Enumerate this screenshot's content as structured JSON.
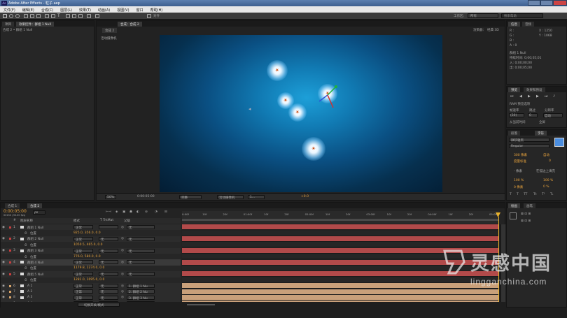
{
  "window": {
    "title": "Adobe After Effects - 粒子.aep"
  },
  "menu": [
    "文件(F)",
    "编辑(E)",
    "合成(C)",
    "图层(L)",
    "效果(T)",
    "动画(A)",
    "视图(V)",
    "窗口",
    "帮助(H)"
  ],
  "toolbar": {
    "snap_label": "对齐",
    "workspace_label": "工作区：",
    "workspace_value": "所有",
    "search_placeholder": "搜索帮助"
  },
  "project_panel": {
    "tabs": [
      "项目",
      "效果控件：群组 1 Null"
    ],
    "breadcrumb": "合成 2 • 群组 1 Null"
  },
  "comp_panel": {
    "tab": "合成：合成 2",
    "subtab": "合成 2",
    "renderer_label": "渲染器：",
    "renderer_value": "经典 3D",
    "camera_label": "活动摄像机",
    "footer": {
      "zoom": "50%",
      "timecode": "0:00:05:00",
      "resolution": "完整",
      "view": "活动摄像机",
      "views": "1...",
      "exposure": "+0.0"
    }
  },
  "info_panel": {
    "tabs": [
      "信息",
      "音频"
    ],
    "rgb": [
      "R :",
      "G :",
      "B :",
      "A : 0"
    ],
    "coords": [
      "X : 1250",
      "Y : 1068"
    ],
    "layer": "群组 1 Null",
    "duration": "持续时间: 0;00;05;01",
    "in": "入: 0;00;00;00",
    "out": "出: 0;00;05;00"
  },
  "preview_panel": {
    "tabs": [
      "预览",
      "效果和预设"
    ],
    "ram_label": "RAM 预览选项",
    "frame_rate_label": "帧速率",
    "skip_label": "跳过",
    "resolution_label": "分辨率",
    "frame_rate_value": "(30)",
    "skip_value": "0",
    "resolution_value": "自动",
    "from_current": "从当前时间",
    "full_screen": "全屏"
  },
  "character_panel": {
    "tabs": [
      "段落",
      "字符"
    ],
    "font": "微软雅黑",
    "style": "Regular",
    "size": "300 像素",
    "leading": "自动",
    "kerning": "度量标准",
    "tracking": "0",
    "stroke_width": "- 像素",
    "stroke_type": "在描边上填充",
    "vertical_scale": "100 %",
    "horizontal_scale": "100 %",
    "baseline": "0 像素",
    "tsume": "0 %",
    "fill_color": "#4b8ee0"
  },
  "paint_panel": {
    "tabs": [
      "绘画",
      "画笔"
    ]
  },
  "timeline": {
    "tabs": [
      "合成 1",
      "合成 2"
    ],
    "timecode": "0:00:05:00",
    "fps": "00150 (30.00 fps)",
    "search_placeholder": "ρ▾",
    "columns": {
      "num": "#",
      "name": "图层名称",
      "mode": "模式",
      "trkmat": "T TrkMat",
      "parent": "父级"
    },
    "ruler": [
      "0:00f",
      "10f",
      "20f",
      "01:00f",
      "10f",
      "20f",
      "02:00f",
      "10f",
      "20f",
      "03:00f",
      "10f",
      "20f",
      "04:00f",
      "10f",
      "20f",
      "05:00"
    ],
    "layers": [
      {
        "num": "1",
        "name": "群组 1 Null",
        "mode": "正常",
        "trk": "",
        "parent": "无",
        "color": "#c93f3f"
      },
      {
        "sub": true,
        "name": "位置",
        "value": "925.0, 356.0, 0.0"
      },
      {
        "num": "2",
        "name": "群组 2 Null",
        "mode": "正常",
        "trk": "无",
        "parent": "无",
        "color": "#c93f3f"
      },
      {
        "sub": true,
        "name": "位置",
        "value": "1050.5, 465.0, 0.0"
      },
      {
        "num": "3",
        "name": "群组 3 Null",
        "mode": "正常",
        "trk": "无",
        "parent": "无",
        "color": "#c93f3f"
      },
      {
        "sub": true,
        "name": "位置",
        "value": "776.0, 580.0, 0.0"
      },
      {
        "num": "4",
        "name": "群组 4 Null",
        "mode": "正常",
        "trk": "无",
        "parent": "无",
        "color": "#c93f3f",
        "selected": true
      },
      {
        "sub": true,
        "name": "位置",
        "value": "1179.8, 1274.0, 0.0"
      },
      {
        "num": "5",
        "name": "群组 5 Null",
        "mode": "正常",
        "trk": "无",
        "parent": "无",
        "color": "#c93f3f"
      },
      {
        "sub": true,
        "name": "位置",
        "value": "1281.0, 1095.0, 0.0"
      },
      {
        "num": "6",
        "name": "A 1",
        "mode": "正常",
        "trk": "无",
        "parent": "1. 群组 1 Nu",
        "color": "#d8a46a"
      },
      {
        "num": "7",
        "name": "A 2",
        "mode": "正常",
        "trk": "无",
        "parent": "2. 群组 2 Nu",
        "color": "#d8a46a"
      },
      {
        "num": "8",
        "name": "A 3",
        "mode": "正常",
        "trk": "无",
        "parent": "3. 群组 3 Nu",
        "color": "#d8a46a"
      },
      {
        "num": "9",
        "name": "A 4",
        "mode": "正常",
        "trk": "无",
        "parent": "4. 群组 4 Nu",
        "color": "#d8a46a"
      }
    ],
    "footer_label": "切换开关/模式"
  },
  "watermark": {
    "cn": "灵感中国",
    "en": "lingganchina.com"
  }
}
